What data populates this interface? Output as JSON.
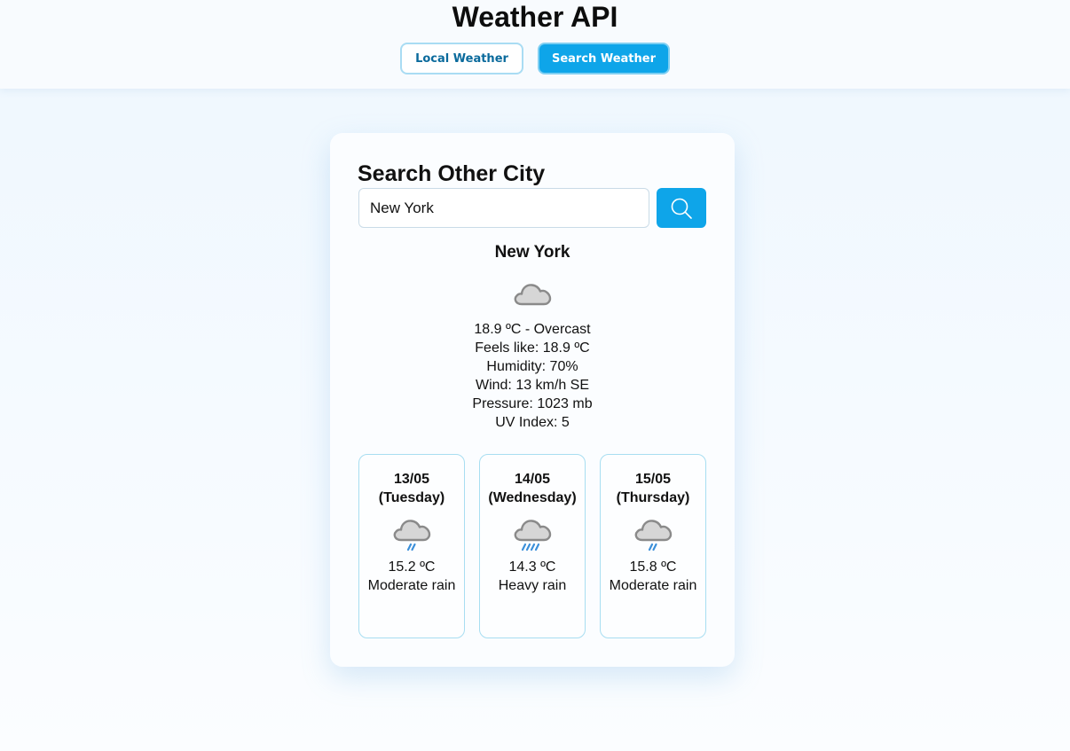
{
  "app": {
    "title": "Weather API"
  },
  "nav": {
    "local_label": "Local Weather",
    "search_label": "Search Weather"
  },
  "search": {
    "heading": "Search Other City",
    "value": "New York",
    "button_icon": "search-icon"
  },
  "current": {
    "city": "New York",
    "icon": "cloud-icon",
    "temp_condition": "18.9 ºC - Overcast",
    "feels_like": "Feels like: 18.9 ºC",
    "humidity": "Humidity: 70%",
    "wind": "Wind: 13 km/h SE",
    "pressure": "Pressure: 1023 mb",
    "uv": "UV Index: 5"
  },
  "forecast": [
    {
      "date": "13/05",
      "weekday": "(Tuesday)",
      "icon": "moderate-rain-icon",
      "temp": "15.2 ºC",
      "condition": "Moderate rain"
    },
    {
      "date": "14/05",
      "weekday": "(Wednesday)",
      "icon": "heavy-rain-icon",
      "temp": "14.3 ºC",
      "condition": "Heavy rain"
    },
    {
      "date": "15/05",
      "weekday": "(Thursday)",
      "icon": "moderate-rain-icon",
      "temp": "15.8 ºC",
      "condition": "Moderate rain"
    }
  ],
  "colors": {
    "accent": "#0ea5e9",
    "border": "#a8def1",
    "rain": "#3b8fd9",
    "cloud": "#d4d4d4"
  }
}
